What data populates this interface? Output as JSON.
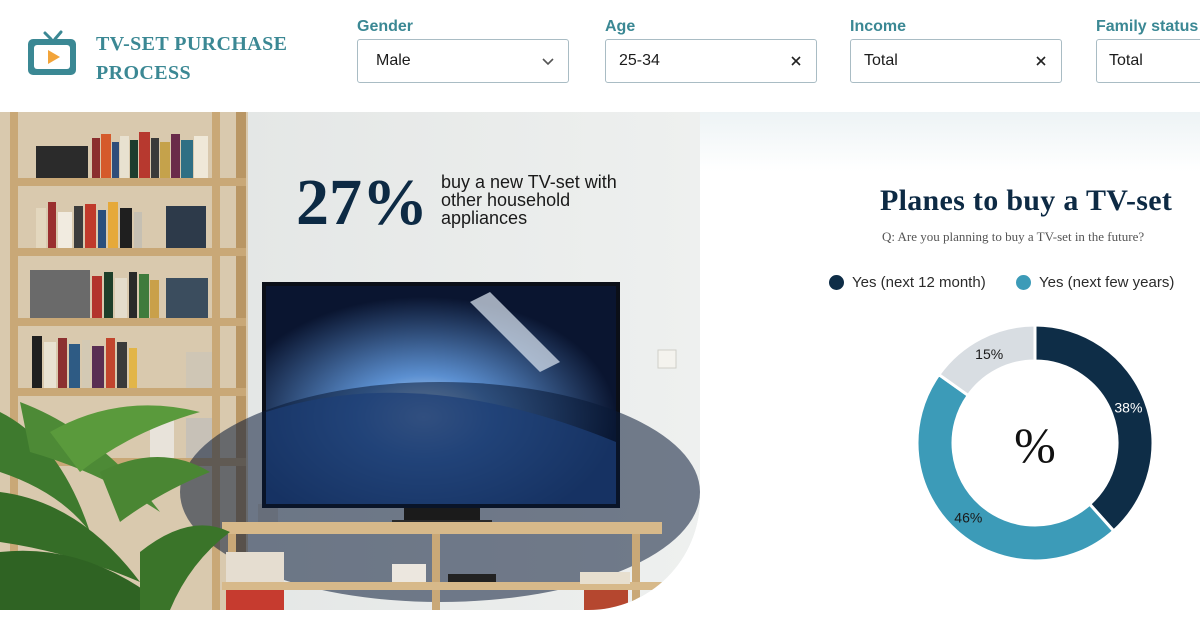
{
  "header": {
    "brand_line1": "TV-SET PURCHASE",
    "brand_line2": "PROCESS",
    "logo_icon": "tv-play-icon"
  },
  "filters": [
    {
      "label": "Gender",
      "value": "Male",
      "control": "chevron-down-icon"
    },
    {
      "label": "Age",
      "value": "25-34",
      "control": "clear-icon"
    },
    {
      "label": "Income",
      "value": "Total",
      "control": "clear-icon"
    },
    {
      "label": "Family status",
      "value": "Total",
      "control": ""
    }
  ],
  "hero": {
    "stat_value": "27%",
    "stat_text": "buy a new TV-set with other household appliances"
  },
  "chart": {
    "title": "Planes to buy a TV-set",
    "subtitle": "Q: Are you planning to buy a TV-set in the future?",
    "center_label": "%"
  },
  "chart_data": {
    "type": "pie",
    "donut": true,
    "series": [
      {
        "name": "Yes (next 12 month)",
        "value": 38,
        "label": "38%",
        "color": "#0e2d47",
        "label_color": "#ffffff"
      },
      {
        "name": "Yes (next few years)",
        "value": 46,
        "label": "46%",
        "color": "#3c9bb8",
        "label_color": "#1a1a1a"
      },
      {
        "value": 15,
        "label": "15%",
        "color": "#d8dde2",
        "label_color": "#1a1a1a"
      }
    ],
    "legend": [
      "Yes (next 12 month)",
      "Yes (next few years)"
    ],
    "legend_position": "top"
  },
  "colors": {
    "brand": "#3b8894",
    "navy": "#0e2d47",
    "teal": "#3c9bb8",
    "grey": "#d8dde2"
  }
}
